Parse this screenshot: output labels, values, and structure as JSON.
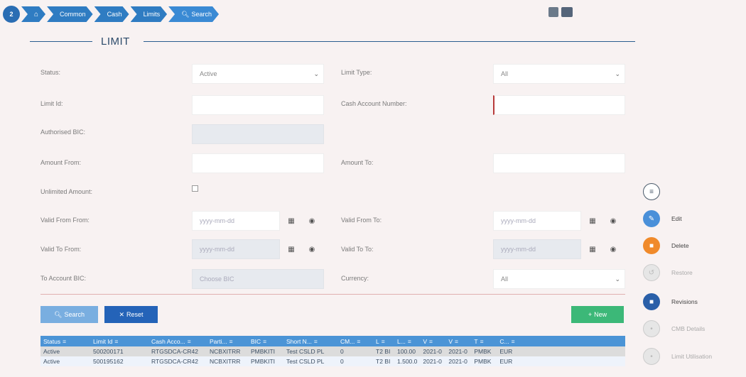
{
  "breadcrumb": {
    "home_badge": "2",
    "items": [
      "Common",
      "Cash",
      "Limits",
      "Search"
    ]
  },
  "page_title": "LIMIT",
  "form": {
    "status_label": "Status:",
    "status_value": "Active",
    "limit_type_label": "Limit Type:",
    "limit_type_value": "All",
    "limit_id_label": "Limit Id:",
    "limit_id_value": "",
    "cash_account_label": "Cash Account Number:",
    "cash_account_value": "",
    "authorised_bic_label": "Authorised BIC:",
    "authorised_bic_value": "",
    "amount_from_label": "Amount From:",
    "amount_from_value": "",
    "amount_to_label": "Amount To:",
    "amount_to_value": "",
    "unlimited_label": "Unlimited Amount:",
    "valid_from_from_label": "Valid From From:",
    "valid_from_to_label": "Valid From To:",
    "valid_to_from_label": "Valid To From:",
    "valid_to_to_label": "Valid To To:",
    "date_placeholder": "yyyy-mm-dd",
    "to_account_bic_label": "To Account BIC:",
    "to_account_bic_placeholder": "Choose BIC",
    "currency_label": "Currency:",
    "currency_value": "All"
  },
  "buttons": {
    "search": "Search",
    "reset": "Reset",
    "new": "New"
  },
  "table": {
    "columns": [
      "Status",
      "Limit Id",
      "Cash Acco...",
      "Parti...",
      "BIC",
      "Short N...",
      "CM...",
      "L",
      "L...",
      "V",
      "V",
      "T",
      "C..."
    ],
    "rows": [
      [
        "Active",
        "500200171",
        "RTGSDCA-CR42",
        "NCBXITRR",
        "PMBKITI",
        "Test CSLD PL",
        "0",
        "T2 BI",
        "100.00",
        "2021-0",
        "2021-0",
        "PMBK",
        "EUR"
      ],
      [
        "Active",
        "500195162",
        "RTGSDCA-CR42",
        "NCBXITRR",
        "PMBKITI",
        "Test CSLD PL",
        "0",
        "T2 BI",
        "1.500.0",
        "2021-0",
        "2021-0",
        "PMBK",
        "EUR"
      ]
    ]
  },
  "side_actions": {
    "edit": "Edit",
    "delete": "Delete",
    "restore": "Restore",
    "revisions": "Revisions",
    "cmb_details": "CMB Details",
    "limit_utilisation": "Limit Utilisation"
  },
  "colors": {
    "breadcrumb": "#2f7cc2",
    "reset_button": "#2463b8",
    "new_button": "#3cb878",
    "delete_action": "#f08a2a",
    "edit_action": "#4a90d9",
    "table_header": "#4b94d6"
  }
}
